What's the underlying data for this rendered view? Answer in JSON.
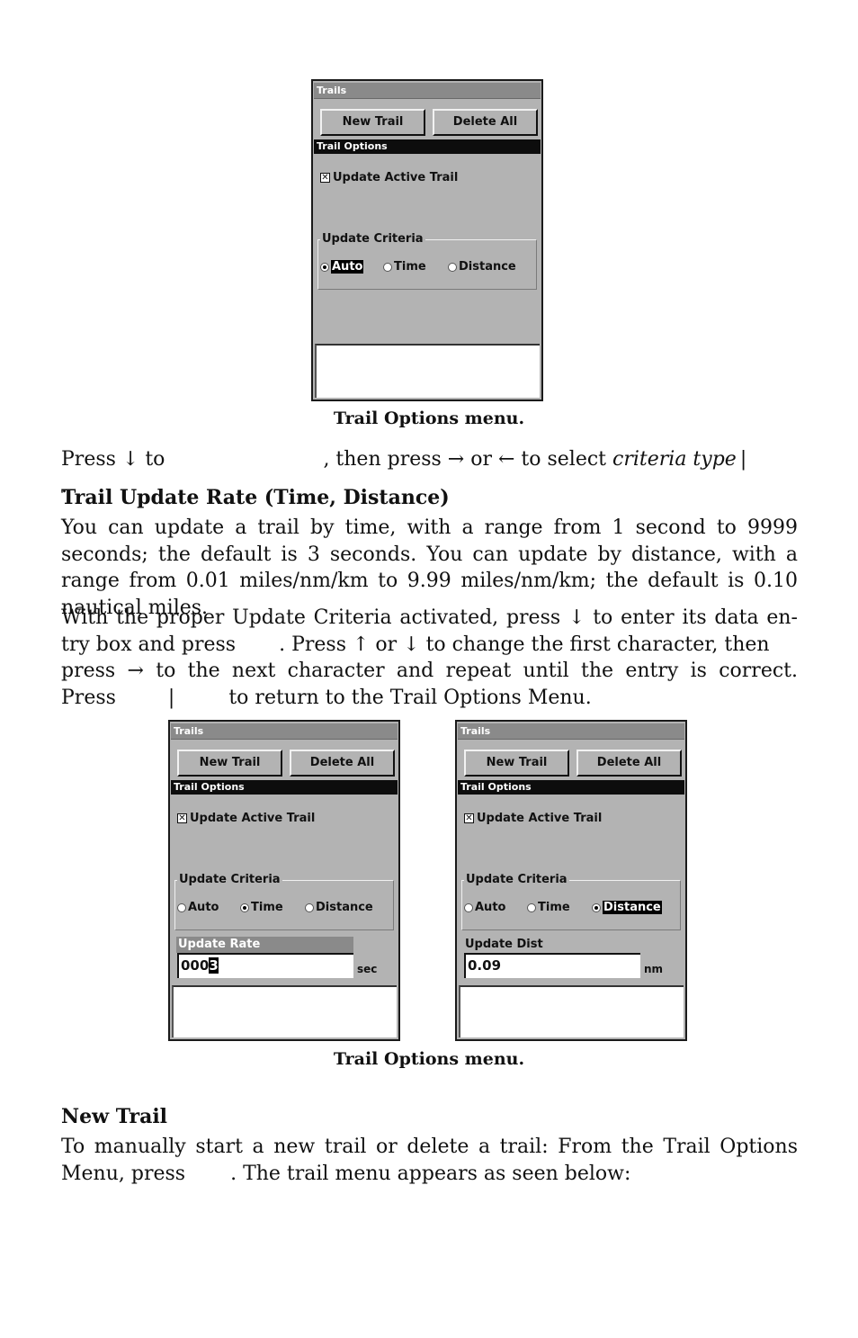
{
  "screens": [
    {
      "title": "Trails",
      "buttons": {
        "new_trail": "New Trail",
        "delete_all": "Delete All"
      },
      "section_bar": "Trail Options",
      "checkbox": {
        "label": "Update Active Trail",
        "checked": true,
        "mark": "✕"
      },
      "group_label": "Update Criteria",
      "radios": [
        {
          "label": "Auto",
          "selected": true
        },
        {
          "label": "Time",
          "selected": false
        },
        {
          "label": "Distance",
          "selected": false
        }
      ]
    },
    {
      "title": "Trails",
      "buttons": {
        "new_trail": "New Trail",
        "delete_all": "Delete All"
      },
      "section_bar": "Trail Options",
      "checkbox": {
        "label": "Update Active Trail",
        "checked": true,
        "mark": "✕"
      },
      "group_label": "Update Criteria",
      "radios": [
        {
          "label": "Auto",
          "selected": false
        },
        {
          "label": "Time",
          "selected": true
        },
        {
          "label": "Distance",
          "selected": false
        }
      ],
      "field": {
        "label": "Update Rate",
        "value_prefix": "000",
        "value_cursor": "3",
        "unit": "sec"
      }
    },
    {
      "title": "Trails",
      "buttons": {
        "new_trail": "New Trail",
        "delete_all": "Delete All"
      },
      "section_bar": "Trail Options",
      "checkbox": {
        "label": "Update Active Trail",
        "checked": true,
        "mark": "✕"
      },
      "group_label": "Update Criteria",
      "radios": [
        {
          "label": "Auto",
          "selected": false
        },
        {
          "label": "Time",
          "selected": false
        },
        {
          "label": "Distance",
          "selected": true
        }
      ],
      "field": {
        "label": "Update Dist",
        "value": "0.09",
        "unit": "nm"
      }
    }
  ],
  "captions": {
    "figure1": "Trail Options menu.",
    "figure2": "Trail Options menu."
  },
  "text": {
    "press_line": {
      "a": "Press ↓ to",
      "b": ", then press → or ← to select",
      "italic": "criteria type",
      "bar": "|",
      "end": "."
    },
    "heading_rate": "Trail Update Rate (Time, Distance)",
    "para_rate": "You can update a trail by time, with a range from 1 second to 9999 seconds; the default is 3 seconds. You can update by distance, with a range from 0.01 miles/nm/km to 9.99 miles/nm/km; the default is 0.10 nautical miles.",
    "para_entry": {
      "l1": "With the proper Update Criteria activated, press ↓ to enter its data en-",
      "l2a": "try box and press",
      "l2b": ". Press ↑ or ↓ to change the first character, then",
      "l3": "press → to the next character and repeat until the entry is correct.",
      "l4a": "Press",
      "l4bar": "|",
      "l4b": "to return to the Trail Options Menu."
    },
    "heading_new": "New Trail",
    "para_new": {
      "l1": "To manually start a new trail or delete a trail: From the Trail Options",
      "l2a": "Menu, press",
      "l2b": ". The trail menu appears as seen below:"
    }
  }
}
